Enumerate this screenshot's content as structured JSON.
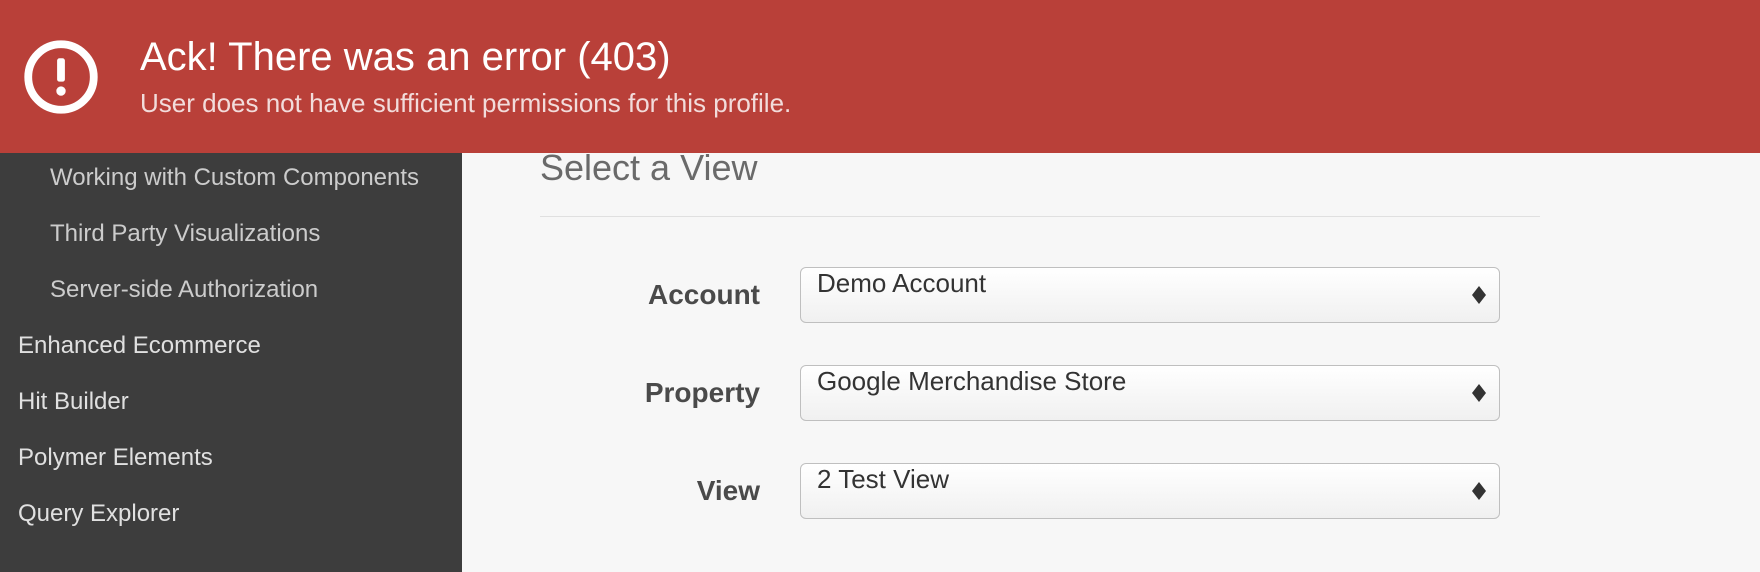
{
  "error": {
    "title": "Ack! There was an error (403)",
    "message": "User does not have sufficient permissions for this profile."
  },
  "sidebar": {
    "subitems": [
      {
        "label": "Working with Custom Components"
      },
      {
        "label": "Third Party Visualizations"
      },
      {
        "label": "Server-side Authorization"
      }
    ],
    "items": [
      {
        "label": "Enhanced Ecommerce"
      },
      {
        "label": "Hit Builder"
      },
      {
        "label": "Polymer Elements"
      },
      {
        "label": "Query Explorer"
      }
    ]
  },
  "main": {
    "section_title": "Select a View",
    "fields": {
      "account": {
        "label": "Account",
        "value": "Demo Account"
      },
      "property": {
        "label": "Property",
        "value": "Google Merchandise Store"
      },
      "view": {
        "label": "View",
        "value": "2 Test View"
      }
    }
  }
}
